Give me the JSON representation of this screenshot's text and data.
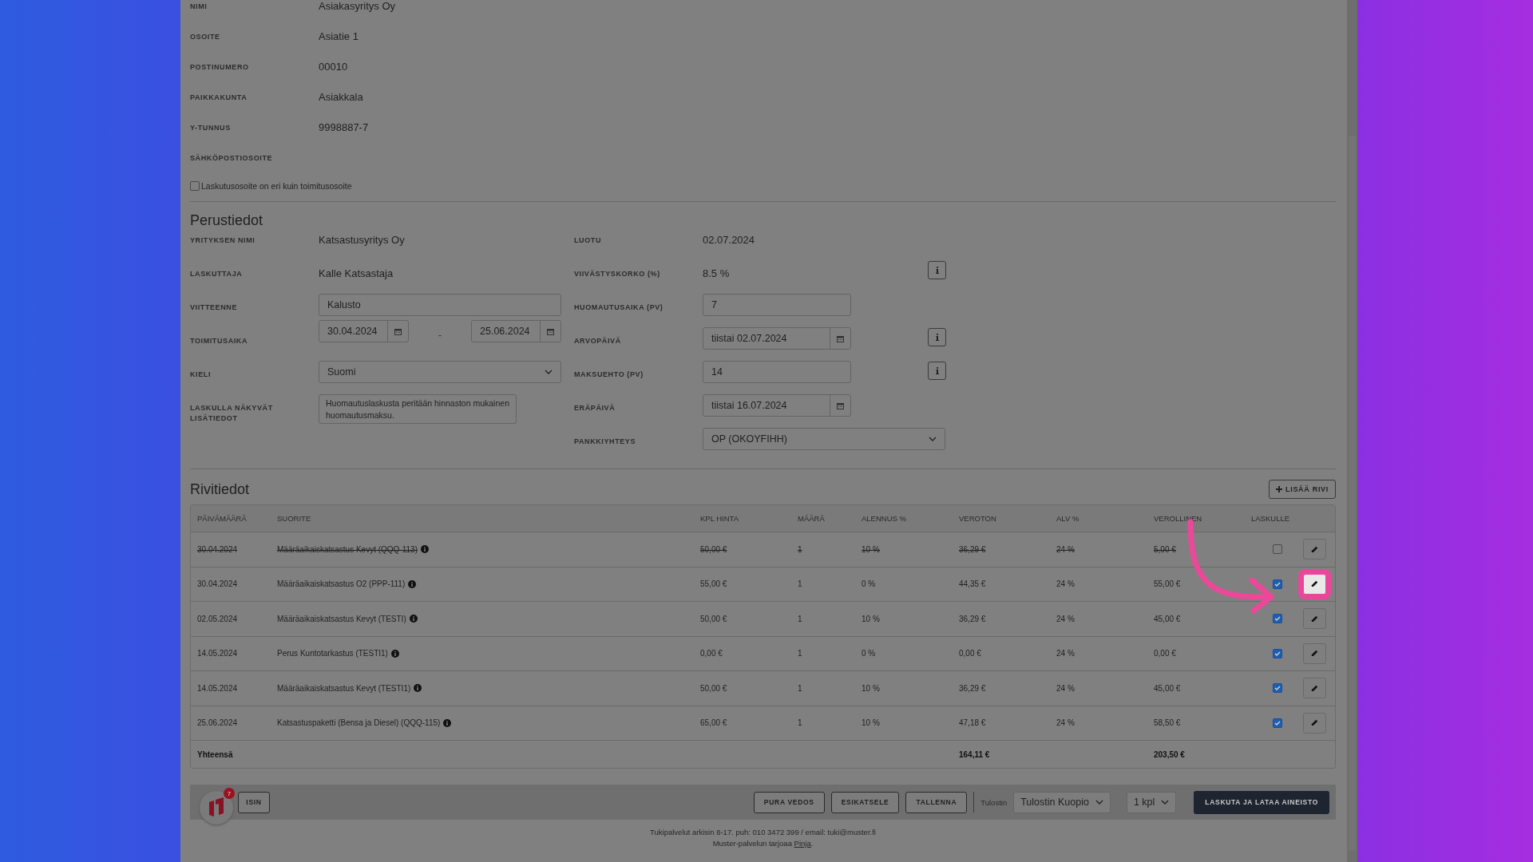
{
  "customer_fields": [
    {
      "label": "NIMI",
      "value": "Asiakasyritys Oy"
    },
    {
      "label": "OSOITE",
      "value": "Asiatie 1"
    },
    {
      "label": "POSTINUMERO",
      "value": "00010"
    },
    {
      "label": "PAIKKAKUNTA",
      "value": "Asiakkala"
    },
    {
      "label": "Y-TUNNUS",
      "value": "9998887-7"
    },
    {
      "label": "SÄHKÖPOSTIOSOITE"
    }
  ],
  "billing_address_checkbox": {
    "label": "Laskutusosoite on eri kuin toimitusosoite",
    "checked": false
  },
  "basic_info": {
    "title": "Perustiedot",
    "left": [
      {
        "kind": "text",
        "label": "YRITYKSEN NIMI",
        "value": "Katsastusyritys Oy"
      },
      {
        "kind": "text",
        "label": "LASKUTTAJA",
        "value": "Kalle Katsastaja"
      },
      {
        "kind": "input",
        "label": "VIITTEENNE",
        "value": "Kalusto"
      },
      {
        "kind": "daterange",
        "label": "TOIMITUSAIKA",
        "value": "30.04.2024",
        "separator": "-",
        "value_end": "25.06.2024"
      },
      {
        "kind": "select",
        "label": "KIELI",
        "value": "Suomi"
      },
      {
        "kind": "textarea",
        "label": "LASKULLA NÄKYVÄT LISÄTIEDOT",
        "value": "Huomautuslaskusta peritään hinnaston mukainen huomautusmaksu."
      }
    ],
    "right": [
      {
        "kind": "text",
        "label": "LUOTU",
        "value": "02.07.2024",
        "info_button": false
      },
      {
        "kind": "text",
        "label": "VIIVÄSTYSKORKO (%)",
        "value": "8.5 %",
        "info_button": true
      },
      {
        "kind": "input",
        "label": "HUOMAUTUSAIKA (PV)",
        "value": "7",
        "info_button": false
      },
      {
        "kind": "date",
        "label": "ARVOPÄIVÄ",
        "value": "tiistai 02.07.2024",
        "info_button": true
      },
      {
        "kind": "input",
        "label": "MAKSUEHTO (PV)",
        "value": "14",
        "info_button": true
      },
      {
        "kind": "date",
        "label": "ERÄPÄIVÄ",
        "value": "tiistai 16.07.2024",
        "info_button": false
      },
      {
        "kind": "select",
        "label": "PANKKIYHTEYS",
        "value": "OP (OKOYFIHH)",
        "info_button": false
      }
    ]
  },
  "line_items": {
    "title": "Rivitiedot",
    "add_button": "LISÄÄ RIVI",
    "columns": [
      "PÄIVÄMÄÄRÄ",
      "SUORITE",
      "KPL HINTA",
      "MÄÄRÄ",
      "ALENNUS %",
      "VEROTON",
      "ALV %",
      "VEROLLINEN",
      "LASKULLE"
    ],
    "rows": [
      {
        "cells": [
          "30.04.2024",
          "Määräaikaiskatsastus Kevyt (QQQ-113)",
          "50,00 €",
          "1",
          "10 %",
          "36,29 €",
          "24 %",
          "5,00 €"
        ],
        "excluded": true,
        "on_invoice": false,
        "highlighted": false
      },
      {
        "cells": [
          "30.04.2024",
          "Määräaikaiskatsastus O2 (PPP-111)",
          "55,00 €",
          "1",
          "0 %",
          "44,35 €",
          "24 %",
          "55,00 €"
        ],
        "excluded": false,
        "on_invoice": true,
        "highlighted": true
      },
      {
        "cells": [
          "02.05.2024",
          "Määräaikaiskatsastus Kevyt (TESTI)",
          "50,00 €",
          "1",
          "10 %",
          "36,29 €",
          "24 %",
          "45,00 €"
        ],
        "excluded": false,
        "on_invoice": true,
        "highlighted": false
      },
      {
        "cells": [
          "14.05.2024",
          "Perus Kuntotarkastus (TESTI1)",
          "0,00 €",
          "1",
          "0 %",
          "0,00 €",
          "24 %",
          "0,00 €"
        ],
        "excluded": false,
        "on_invoice": true,
        "highlighted": false
      },
      {
        "cells": [
          "14.05.2024",
          "Määräaikaiskatsastus Kevyt (TESTI1)",
          "50,00 €",
          "1",
          "10 %",
          "36,29 €",
          "24 %",
          "45,00 €"
        ],
        "excluded": false,
        "on_invoice": true,
        "highlighted": false
      },
      {
        "cells": [
          "25.06.2024",
          "Katsastuspaketti (Bensa ja Diesel) (QQQ-115)",
          "65,00 €",
          "1",
          "10 %",
          "47,18 €",
          "24 %",
          "58,50 €"
        ],
        "excluded": false,
        "on_invoice": true,
        "highlighted": false
      }
    ],
    "total": {
      "label": "Yhteensä",
      "net": "164,11 €",
      "gross": "203,50 €"
    }
  },
  "action_bar": {
    "back_button": "ISIN",
    "notification_badge": "7",
    "buttons": [
      "PURA VEDOS",
      "ESIKATSELE",
      "TALLENNA"
    ],
    "printer_label": "Tulostin",
    "printer": "Tulostin Kuopio",
    "copies": "1 kpl",
    "primary_button": "LASKUTA JA LATAA AINEISTO"
  },
  "footer": {
    "line1": "Tukipalvelut arkisin 8-17. puh: 010 3472 399 / email: tuki@muster.fi",
    "line2_before": "Muster-palvelun tarjoaa ",
    "link": "Pinja",
    "line2_after": "."
  }
}
